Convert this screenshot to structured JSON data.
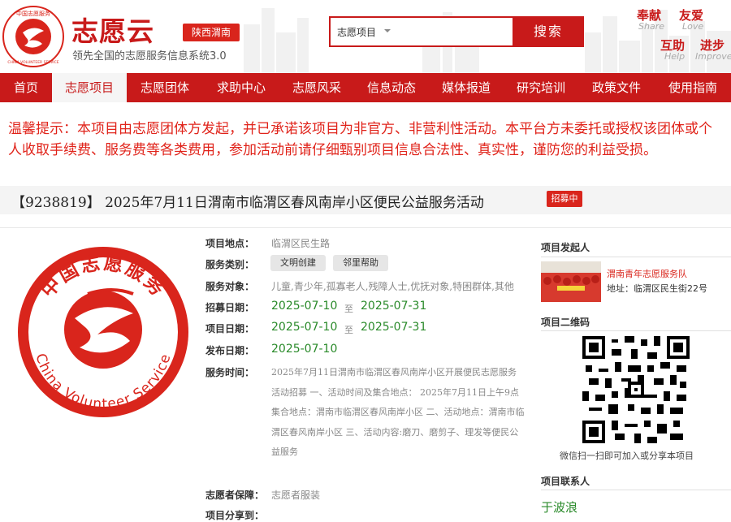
{
  "header": {
    "brand": "志愿云",
    "region": "陕西渭南",
    "slogan": "领先全国的志愿服务信息系统3.0",
    "search": {
      "selected": "志愿项目",
      "button": "搜索"
    },
    "motto": [
      {
        "cn": "奉献",
        "en": "Share"
      },
      {
        "cn": "友爱",
        "en": "Love"
      },
      {
        "cn": "互助",
        "en": "Help"
      },
      {
        "cn": "进步",
        "en": "Improve"
      }
    ],
    "logo_text_top": "中国志愿服务",
    "logo_text_bottom": "CHINA VOLUNTEER SERVICE"
  },
  "nav": {
    "items": [
      "首页",
      "志愿项目",
      "志愿团体",
      "求助中心",
      "志愿风采",
      "信息动态",
      "媒体报道",
      "研究培训",
      "政策文件",
      "使用指南"
    ],
    "active": "志愿项目"
  },
  "notice": "温馨提示：本项目由志愿团体方发起，并已承诺该项目为非官方、非营利性活动。本平台方未委托或授权该团体或个人收取手续费、服务费等各类费用，参加活动前请仔细甄别项目信息合法性、真实性，谨防您的利益受损。",
  "project": {
    "title": "【9238819】 2025年7月11日渭南市临渭区春风南岸小区便民公益服务活动",
    "status": "招募中",
    "logo_text_top": "中国志愿服务",
    "logo_text_bottom": "China Volunteer Service",
    "fields": {
      "location_label": "项目地点：",
      "location": "临渭区民生路",
      "category_label": "服务类别：",
      "categories": [
        "文明创建",
        "邻里帮助"
      ],
      "targets_label": "服务对象：",
      "targets": "儿童,青少年,孤寡老人,残障人士,优抚对象,特困群体,其他",
      "recruit_label": "招募日期：",
      "recruit_start": "2025-07-10",
      "recruit_end": "2025-07-31",
      "project_date_label": "项目日期：",
      "project_start": "2025-07-10",
      "project_end": "2025-07-31",
      "publish_label": "发布日期：",
      "publish_date": "2025-07-10",
      "to": "至",
      "service_time_label": "服务时间：",
      "service_time": "2025年7月11日渭南市临渭区春风南岸小区开展便民志愿服务活动招募 一、活动时间及集合地点： 2025年7月11日上午9点 集合地点：渭南市临渭区春风南岸小区 二、活动地点：渭南市临渭区春风南岸小区 三、活动内容:磨刀、磨剪子、理发等便民公益服务",
      "guarantee_label": "志愿者保障：",
      "guarantee": "志愿者服装",
      "share_label": "项目分享到："
    }
  },
  "sidebar": {
    "initiator_title": "项目发起人",
    "org_name": "渭南青年志愿服务队",
    "org_address": "地址：临渭区民生街22号",
    "qr_title": "项目二维码",
    "qr_caption": "微信扫一扫即可加入或分享本项目",
    "contact_title": "项目联系人",
    "contact_name": "于波浪"
  },
  "colors": {
    "brand_red": "#c81a1a",
    "date_green": "#2a8a2a",
    "notice_red": "#e0231a"
  }
}
